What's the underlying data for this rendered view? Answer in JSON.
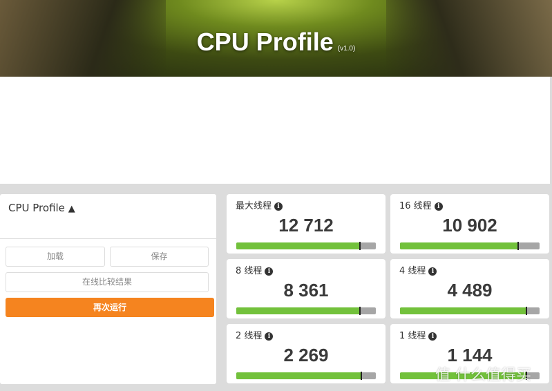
{
  "banner": {
    "title": "CPU Profile",
    "version": "(v1.0)"
  },
  "panel": {
    "title": "CPU Profile",
    "warning_icon": "warning-icon",
    "load": "加载",
    "save": "保存",
    "compare": "在线比较结果",
    "run_again": "再次运行"
  },
  "cards": [
    {
      "label": "最大线程",
      "score": "12 712",
      "fraction": 0.88
    },
    {
      "label": "16 线程",
      "score": "10 902",
      "fraction": 0.84
    },
    {
      "label": "8 线程",
      "score": "8 361",
      "fraction": 0.88
    },
    {
      "label": "4 线程",
      "score": "4 489",
      "fraction": 0.9
    },
    {
      "label": "2 线程",
      "score": "2 269",
      "fraction": 0.89
    },
    {
      "label": "1 线程",
      "score": "1 144",
      "fraction": 0.9
    }
  ],
  "info_icon": "i",
  "colors": {
    "bar_fill": "#72c13b",
    "bar_bg": "#a6a6a6",
    "run_button": "#f5841f"
  },
  "watermark": "值 什么值得买"
}
